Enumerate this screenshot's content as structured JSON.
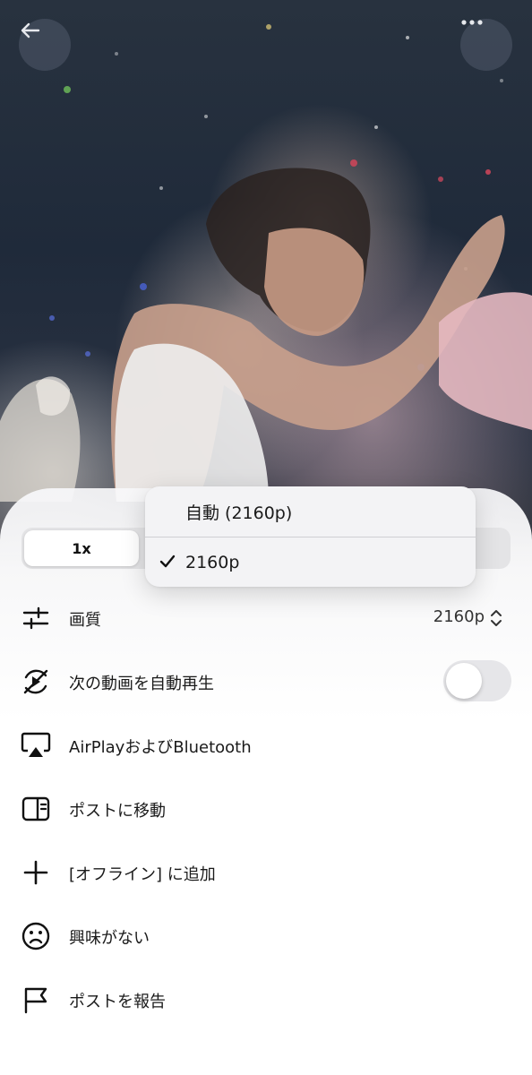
{
  "video": {
    "back_icon": "arrow-left-icon",
    "more_icon": "ellipsis-icon"
  },
  "playback_speed": {
    "selected": "1x"
  },
  "quality_menu": {
    "options": [
      {
        "label": "自動 (2160p)",
        "selected": false
      },
      {
        "label": "2160p",
        "selected": true
      }
    ],
    "check_icon": "checkmark-icon"
  },
  "menu": {
    "quality": {
      "label": "画質",
      "value": "2160p",
      "icon": "sliders-icon"
    },
    "autoplay": {
      "label": "次の動画を自動再生",
      "icon": "autoplay-off-icon",
      "enabled": false
    },
    "airplay": {
      "label": "AirPlayおよびBluetooth",
      "icon": "airplay-icon"
    },
    "go_to_post": {
      "label": "ポストに移動",
      "icon": "panel-icon"
    },
    "add_offline": {
      "label": "[オフライン] に追加",
      "icon": "plus-icon"
    },
    "not_interested": {
      "label": "興味がない",
      "icon": "frown-icon"
    },
    "report": {
      "label": "ポストを報告",
      "icon": "flag-icon"
    }
  },
  "colors": {
    "sheet_bg": "#ffffff",
    "toggle_off": "#e6e6e9",
    "text": "#1a1a1a"
  }
}
